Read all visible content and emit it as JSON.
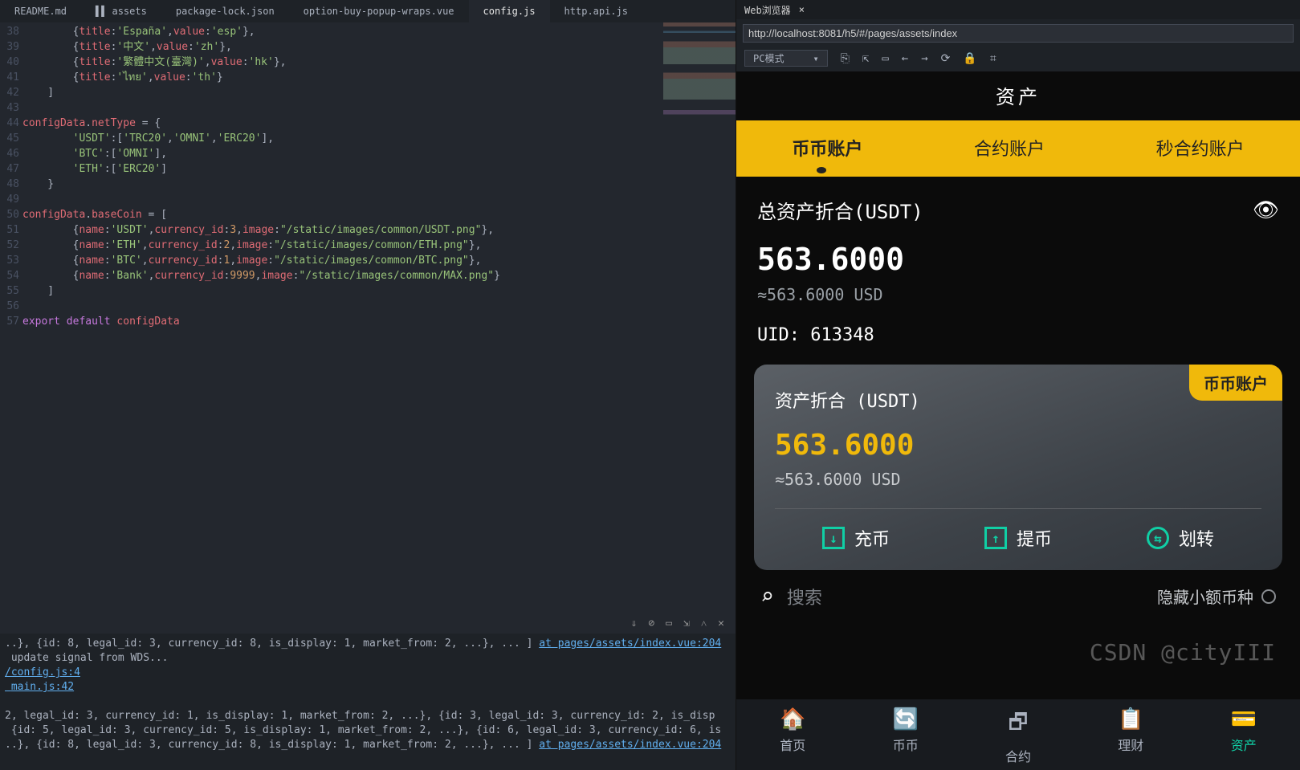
{
  "tabs": [
    "README.md",
    "assets",
    "package-lock.json",
    "option-buy-popup-wraps.vue",
    "config.js",
    "http.api.js"
  ],
  "active_tab": "config.js",
  "gutter_start": 38,
  "code_lines": [
    "{title:'España',value:'esp'},",
    "{title:'中文',value:'zh'},",
    "{title:'繁體中文(臺灣)',value:'hk'},",
    "{title:'ไทย',value:'th'}",
    "]",
    "",
    "configData.netType = {",
    "'USDT':['TRC20','OMNI','ERC20'],",
    "'BTC':['OMNI'],",
    "'ETH':['ERC20']",
    "}",
    "",
    "configData.baseCoin = [",
    "{name:'USDT',currency_id:3,image:\"/static/images/common/USDT.png\"},",
    "{name:'ETH',currency_id:2,image:\"/static/images/common/ETH.png\"},",
    "{name:'BTC',currency_id:1,image:\"/static/images/common/BTC.png\"},",
    "{name:'Bank',currency_id:9999,image:\"/static/images/common/MAX.png\"}",
    "]",
    "",
    "export default configData"
  ],
  "term_icons": [
    "⇓",
    "⊘",
    "▭",
    "⇲",
    "˄",
    "✕"
  ],
  "terminal": {
    "line1_a": "..}, {id: 8, legal_id: 3, currency_id: 8, is_display: 1, market_from: 2, ...}, ... ] ",
    "link1": "at pages/assets/index.vue:204",
    "line2": " update signal from WDS...",
    "link2": "/config.js:4",
    "link3": " main.js:42",
    "line3": "2, legal_id: 3, currency_id: 1, is_display: 1, market_from: 2, ...}, {id: 3, legal_id: 3, currency_id: 2, is_disp",
    "line4": " {id: 5, legal_id: 3, currency_id: 5, is_display: 1, market_from: 2, ...}, {id: 6, legal_id: 3, currency_id: 6, is",
    "line5_a": "..}, {id: 8, legal_id: 3, currency_id: 8, is_display: 1, market_from: 2, ...}, ... ] ",
    "link4": "at pages/assets/index.vue:204"
  },
  "panel": {
    "title": "Web浏览器",
    "url": "http://localhost:8081/h5/#/pages/assets/index",
    "mode": "PC模式",
    "tool_icons": [
      "⎘",
      "⇱",
      "▭",
      "←",
      "→",
      "⟳",
      "🔒",
      "⌗"
    ]
  },
  "device": {
    "header": "资产",
    "tabs": [
      "币币账户",
      "合约账户",
      "秒合约账户"
    ],
    "total_label": "总资产折合(USDT)",
    "total_value": "563.6000",
    "total_sub": "≈563.6000 USD",
    "uid": "UID: 613348",
    "card_badge": "币币账户",
    "card_label": "资产折合 (USDT)",
    "card_value": "563.6000",
    "card_sub": "≈563.6000 USD",
    "actions": [
      "充币",
      "提币",
      "划转"
    ],
    "search_ph": "搜索",
    "hide_small": "隐藏小额币种",
    "nav": [
      "首页",
      "币币",
      "合约",
      "理财",
      "资产"
    ],
    "nav_icons": [
      "🏠",
      "🔄",
      "🗗",
      "📋",
      "💳"
    ]
  },
  "watermark": "CSDN @cityIII"
}
